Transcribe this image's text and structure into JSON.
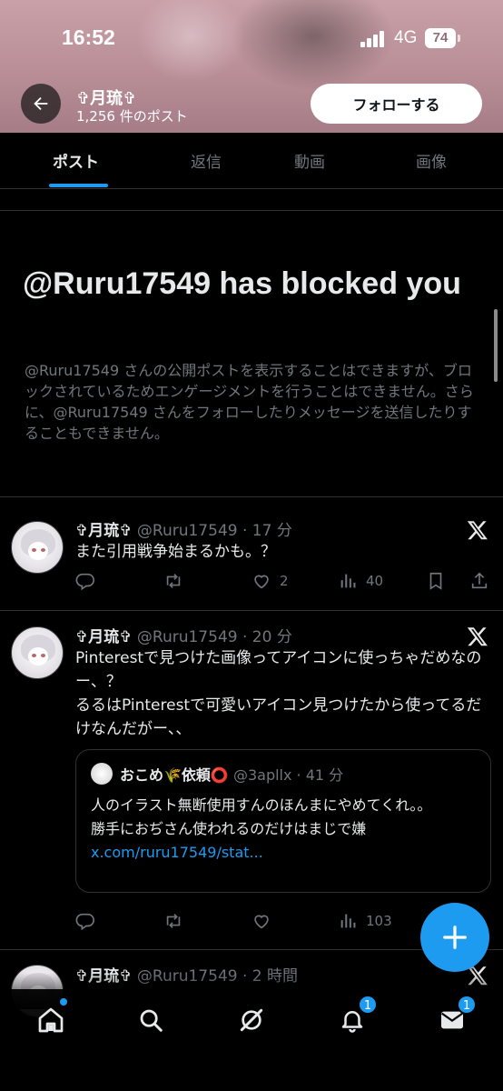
{
  "status_bar": {
    "time": "16:52",
    "network": "4G",
    "battery": "74"
  },
  "header": {
    "profile_name": "✞月琉✞",
    "post_count": "1,256 件のポスト",
    "follow_label": "フォローする"
  },
  "tabs": [
    "ポスト",
    "返信",
    "動画",
    "画像"
  ],
  "blocked": {
    "title": "@Ruru17549 has blocked you",
    "description": "@Ruru17549 さんの公開ポストを表示することはできますが、ブロックされているためエンゲージメントを行うことはできません。さらに、@Ruru17549 さんをフォローしたりメッセージを送信したりすることもできません。"
  },
  "posts": [
    {
      "name": "✞月琉✞",
      "handle_time": "@Ruru17549 · 17 分",
      "text": "また引用戦争始まるかも。？",
      "likes": "2",
      "views": "40"
    },
    {
      "name": "✞月琉✞",
      "handle_time": "@Ruru17549 · 20 分",
      "text": "Pinterestで見つけた画像ってアイコンに使っちゃだめなのー、？\nるるはPinterestで可愛いアイコン見つけたから使ってるだけなんだがー、、",
      "quote": {
        "name": "おこめ🌾依頼⭕",
        "handle_time": "@3apllx · 41 分",
        "text": "人のイラスト無断使用すんのほんまにやめてくれ。。\n勝手におぢさん使われるのだけはまじで嫌 ",
        "link": "x.com/ruru17549/stat..."
      },
      "views": "103"
    },
    {
      "name": "✞月琉✞",
      "handle_time": "@Ruru17549 · 2 時間"
    }
  ],
  "nav": {
    "notifications_badge": "1",
    "messages_badge": "1"
  },
  "colors": {
    "accent": "#1d9bf0",
    "background": "#000000",
    "muted": "#71767b"
  },
  "icons": [
    "back-arrow-icon",
    "x-logo-icon",
    "reply-icon",
    "repost-icon",
    "like-icon",
    "views-icon",
    "bookmark-icon",
    "share-icon",
    "compose-plus-icon",
    "home-icon",
    "search-icon",
    "grok-icon",
    "bell-icon",
    "mail-icon"
  ]
}
